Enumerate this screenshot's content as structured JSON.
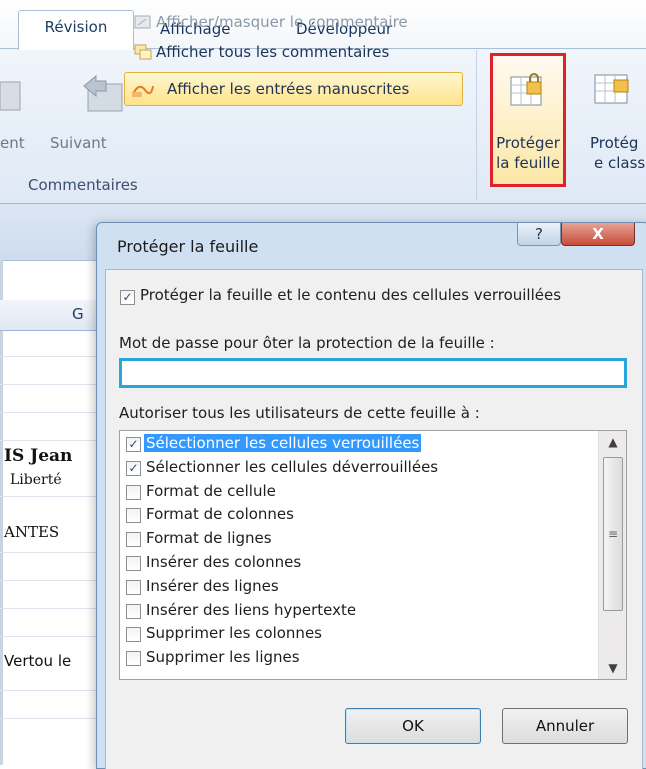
{
  "ribbon": {
    "tabs": [
      "Révision",
      "Affichage",
      "Développeur"
    ],
    "left_fragments": {
      "prev_label": "ent",
      "next_label": "Suivant"
    },
    "commands": {
      "show_hide_comment": "Afficher/masquer le commentaire",
      "show_all_comments": "Afficher tous les commentaires",
      "show_ink": "Afficher les entrées manuscrites"
    },
    "group_label": "Commentaires",
    "protect_sheet": {
      "line1": "Protéger",
      "line2": "la feuille"
    },
    "protect_workbook": {
      "line1": "Protég",
      "line2": "e class"
    }
  },
  "sheet": {
    "column_header": "G",
    "cells": [
      "IS Jean",
      "Liberté",
      "ANTES",
      "Vertou le"
    ]
  },
  "dialog": {
    "title": "Protéger la feuille",
    "help_glyph": "?",
    "close_glyph": "X",
    "protect_label": "Protéger la feuille et le contenu des cellules verrouillées",
    "protect_checked": true,
    "password_label": "Mot de passe pour ôter la protection de la feuille :",
    "password_value": "",
    "allow_label": "Autoriser tous les utilisateurs de cette feuille à :",
    "permissions": [
      {
        "label": "Sélectionner les cellules verrouillées",
        "checked": true,
        "selected": true
      },
      {
        "label": "Sélectionner les cellules déverrouillées",
        "checked": true,
        "selected": false
      },
      {
        "label": "Format de cellule",
        "checked": false,
        "selected": false
      },
      {
        "label": "Format de colonnes",
        "checked": false,
        "selected": false
      },
      {
        "label": "Format de lignes",
        "checked": false,
        "selected": false
      },
      {
        "label": "Insérer des colonnes",
        "checked": false,
        "selected": false
      },
      {
        "label": "Insérer des lignes",
        "checked": false,
        "selected": false
      },
      {
        "label": "Insérer des liens hypertexte",
        "checked": false,
        "selected": false
      },
      {
        "label": "Supprimer les colonnes",
        "checked": false,
        "selected": false
      },
      {
        "label": "Supprimer les lignes",
        "checked": false,
        "selected": false
      }
    ],
    "ok_label": "OK",
    "cancel_label": "Annuler"
  }
}
